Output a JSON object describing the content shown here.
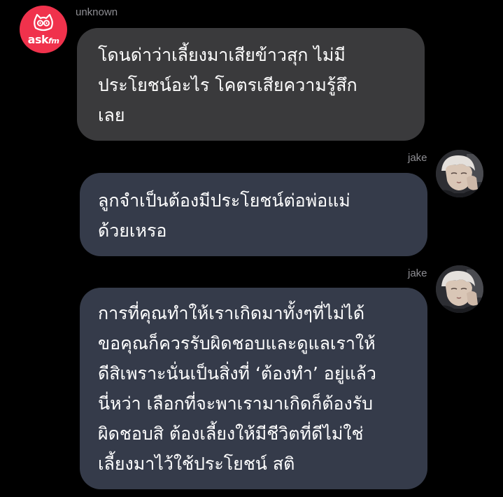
{
  "messages": [
    {
      "sender": "unknown",
      "avatar_icon": "askfm-logo-icon",
      "avatar_text": "ask",
      "avatar_text_suffix": "fm",
      "avatar_color": "#f0324c",
      "bubble_color": "#3a3a3c",
      "lines": [
        "โดนด่าว่าเลี้ยงมาเสียข้าวสุก ไม่มี",
        "ประโยชน์อะไร โคตรเสียความรู้สึก",
        "เลย"
      ]
    },
    {
      "sender": "jake",
      "avatar_icon": "profile-photo-icon",
      "bubble_color": "#353b4a",
      "lines": [
        "ลูกจำเป็นต้องมีประโยชน์ต่อพ่อแม่",
        "ด้วยเหรอ"
      ]
    },
    {
      "sender": "jake",
      "avatar_icon": "profile-photo-icon",
      "bubble_color": "#353b4a",
      "lines": [
        "การที่คุณทำให้เราเกิดมาทั้งๆที่ไม่ได้",
        "ขอคุณก็ควรรับผิดชอบและดูแลเราให้",
        "ดีสิเพราะนั่นเป็นสิ่งที่ ‘ต้องทำ’ อยู่แล้ว",
        "นี่หว่า เลือกที่จะพาเรามาเกิดก็ต้องรับ",
        "ผิดชอบสิ ต้องเลี้ยงให้มีชีวิตที่ดีไม่ใช่",
        "เลี้ยงมาไว้ใช้ประโยชน์ สติ"
      ]
    }
  ]
}
